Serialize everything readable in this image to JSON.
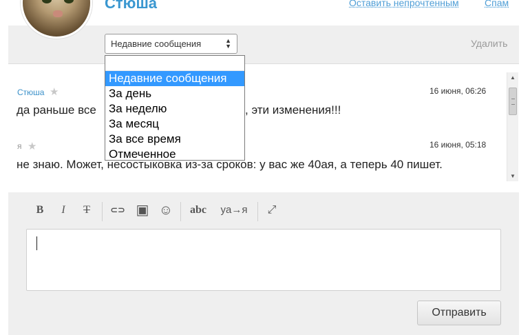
{
  "header": {
    "username": "Стюша",
    "mark_unread_label": "Оставить непрочтенным",
    "spam_label": "Спам"
  },
  "filter": {
    "selected_label": "Недавние сообщения",
    "delete_label": "Удалить",
    "options": [
      {
        "label": "Недавние сообщения",
        "selected": true
      },
      {
        "label": "За день"
      },
      {
        "label": "За неделю"
      },
      {
        "label": "За месяц"
      },
      {
        "label": "За все время"
      },
      {
        "label": "Отмеченное"
      }
    ]
  },
  "messages": [
    {
      "author": "Стюша",
      "time": "16 июня, 06:26",
      "text_before": "да раньше все",
      "text_after": ", эти изменения!!!"
    },
    {
      "author": "я",
      "time": "16 июня, 05:18",
      "text": "не знаю. Может, несостыковка из-за сроков: у вас же 40ая, а теперь 40 пишет."
    }
  ],
  "toolbar": {
    "bold": "B",
    "italic": "I",
    "strike": "T",
    "link": "⊂⊃",
    "image": "▣",
    "emoji": "☺",
    "spellcheck": "abc",
    "translit": "ya→я",
    "fullscreen": "⤢"
  },
  "composer": {
    "send_label": "Отправить"
  }
}
